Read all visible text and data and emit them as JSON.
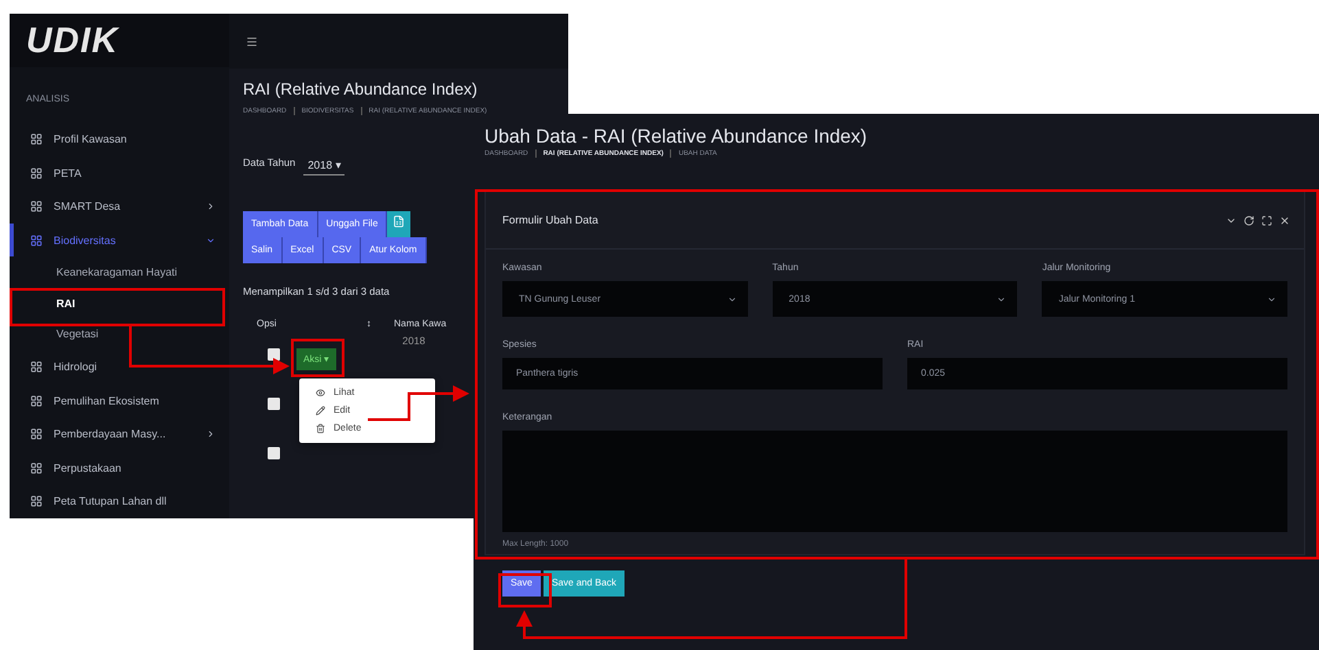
{
  "list_screen": {
    "logo": "UDIK",
    "sidebar": {
      "heading": "ANALISIS",
      "items": [
        {
          "label": "Profil Kawasan",
          "selected": false
        },
        {
          "label": "PETA",
          "selected": false
        },
        {
          "label": "SMART Desa",
          "expanded": false,
          "selected": false
        },
        {
          "label": "Biodiversitas",
          "expanded": true,
          "selected": true,
          "children": [
            {
              "label": "Keanekaragaman Hayati",
              "selected": false
            },
            {
              "label": "RAI",
              "selected": true
            },
            {
              "label": "Vegetasi",
              "selected": false
            }
          ]
        },
        {
          "label": "Hidrologi",
          "selected": false
        },
        {
          "label": "Pemulihan Ekosistem",
          "selected": false
        },
        {
          "label": "Pemberdayaan Masy...",
          "expanded": false,
          "selected": false
        },
        {
          "label": "Perpustakaan",
          "selected": false
        },
        {
          "label": "Peta Tutupan Lahan dll",
          "selected": false
        }
      ]
    },
    "title": "RAI (Relative Abundance Index)",
    "breadcrumb": [
      "DASHBOARD",
      "BIODIVERSITAS",
      "RAI (RELATIVE ABUNDANCE INDEX)"
    ],
    "year_label": "Data Tahun",
    "year_value": "2018 ▾",
    "action_buttons": [
      "Tambah Data",
      "Unggah File"
    ],
    "export_buttons": [
      "Salin",
      "Excel",
      "CSV",
      "Atur Kolom"
    ],
    "summary": "Menampilkan 1 s/d 3 dari 3 data",
    "columns": [
      "Opsi",
      "↕",
      "Nama Kawa"
    ],
    "rows": [
      {
        "checked": false,
        "action": "Aksi ▾",
        "cell": "2018"
      },
      {
        "checked": false
      },
      {
        "checked": false
      }
    ],
    "row_menu": [
      {
        "kind": "view",
        "label": "Lihat"
      },
      {
        "kind": "edit",
        "label": "Edit"
      },
      {
        "kind": "delete",
        "label": "Delete"
      }
    ]
  },
  "edit_screen": {
    "title": "Ubah Data - RAI (Relative Abundance Index)",
    "breadcrumb": [
      "DASHBOARD",
      "RAI (RELATIVE ABUNDANCE INDEX)",
      "UBAH DATA"
    ],
    "card_title": "Formulir Ubah Data",
    "selects": [
      {
        "label": "Kawasan",
        "value": "TN Gunung Leuser"
      },
      {
        "label": "Tahun",
        "value": "2018"
      },
      {
        "label": "Jalur Monitoring",
        "value": "Jalur Monitoring 1"
      }
    ],
    "inputs": [
      {
        "label": "Spesies",
        "value": "Panthera tigris"
      },
      {
        "label": "RAI",
        "value": "0.025"
      }
    ],
    "notes": {
      "label": "Keterangan",
      "hint": "Max Length: 1000"
    },
    "buttons": [
      {
        "kind": "primary",
        "label": "Save"
      },
      {
        "kind": "secondary",
        "label": "Save and Back"
      }
    ]
  }
}
